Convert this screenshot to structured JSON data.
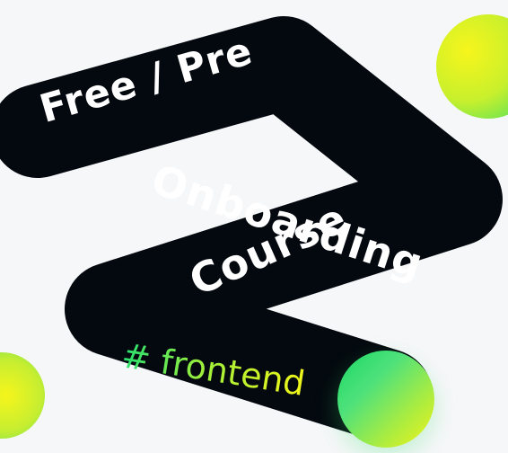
{
  "ribbon": {
    "line1": "Free / Pre",
    "line2": "Onboarding",
    "line3": "Course",
    "tag": "# frontend"
  },
  "colors": {
    "background": "#f6f7f9",
    "ribbon": "#04090f",
    "text": "#ffffff",
    "accent_green": "#27e070",
    "accent_yellow": "#f1f51a"
  },
  "icons": {
    "top_right": "gradient-circle",
    "bottom_left": "gradient-circle",
    "ribbon_end": "gradient-circle"
  }
}
